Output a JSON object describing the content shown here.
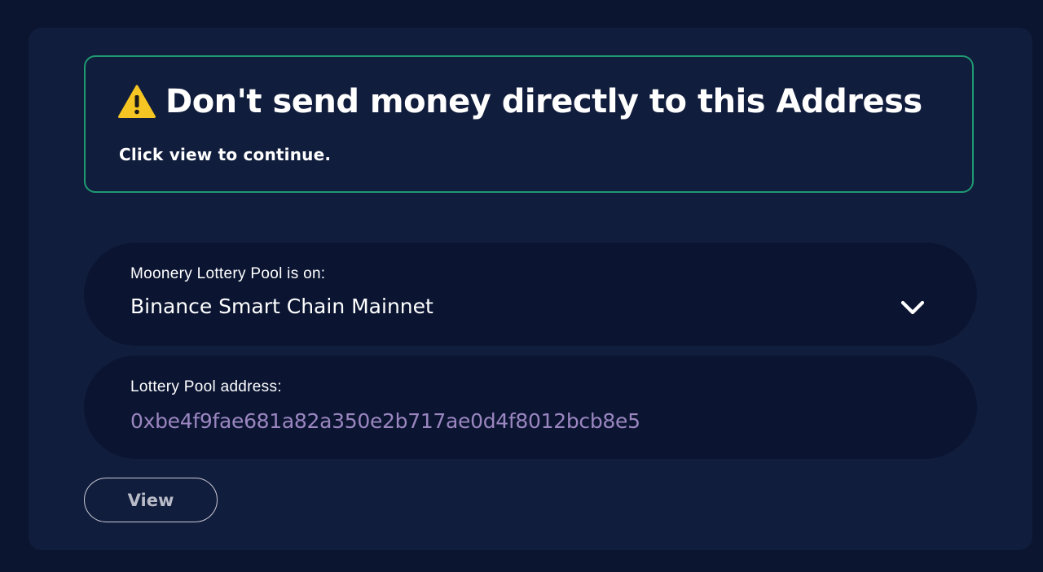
{
  "warning": {
    "icon": "warning-triangle-icon",
    "title": "Don't send money directly to this Address",
    "subtitle": "Click view to continue.",
    "border_color": "#1f9a72"
  },
  "network": {
    "label": "Moonery Lottery Pool is on:",
    "value": "Binance Smart Chain Mainnet",
    "icon": "chevron-down-icon"
  },
  "address": {
    "label": "Lottery Pool address:",
    "value": "0xbe4f9fae681a82a350e2b717ae0d4f8012bcb8e5",
    "value_color": "#9b86c0"
  },
  "actions": {
    "view_label": "View"
  },
  "colors": {
    "background": "#0b1530",
    "panel": "#111d3c",
    "field": "#0b1532"
  }
}
